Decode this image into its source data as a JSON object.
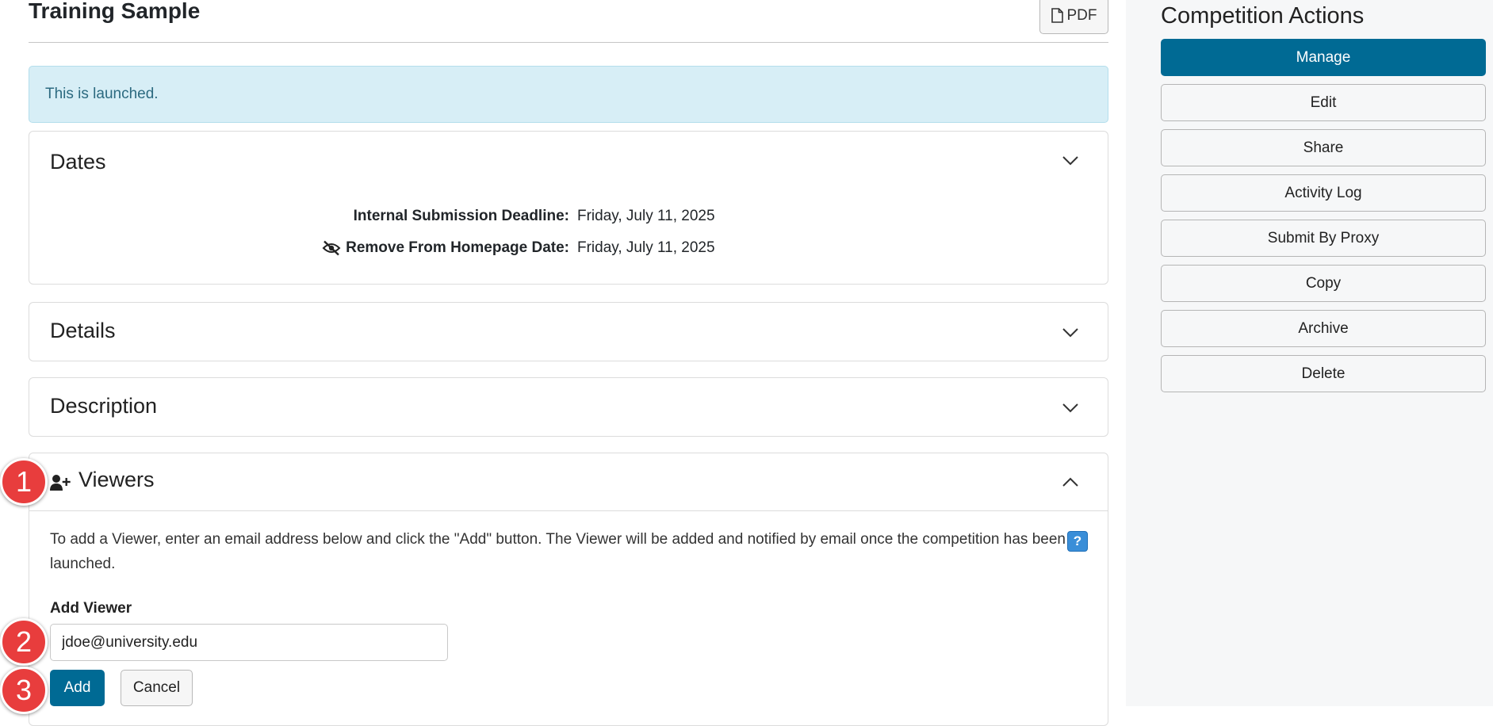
{
  "header": {
    "title": "Training Sample",
    "pdf_label": "PDF"
  },
  "alert": {
    "text": "This is launched."
  },
  "dates": {
    "title": "Dates",
    "rows": [
      {
        "label": "Internal Submission Deadline:",
        "value": "Friday, July 11, 2025"
      },
      {
        "label": "Remove From Homepage Date:",
        "value": "Friday, July 11, 2025",
        "icon": "eye-slash-icon"
      }
    ]
  },
  "details": {
    "title": "Details"
  },
  "description": {
    "title": "Description"
  },
  "viewers": {
    "title": "Viewers",
    "icon": "user-plus-icon",
    "help_text": "To add a Viewer, enter an email address below and click the \"Add\" button. The Viewer will be added and notified by email once the competition has been launched.",
    "help_badge": "?",
    "field_label": "Add Viewer",
    "email_value": "jdoe@university.edu",
    "add_label": "Add",
    "cancel_label": "Cancel"
  },
  "sidebar": {
    "title": "Competition Actions",
    "actions": [
      {
        "label": "Manage",
        "primary": true
      },
      {
        "label": "Edit"
      },
      {
        "label": "Share"
      },
      {
        "label": "Activity Log"
      },
      {
        "label": "Submit By Proxy"
      },
      {
        "label": "Copy"
      },
      {
        "label": "Archive"
      },
      {
        "label": "Delete"
      }
    ]
  },
  "callouts": [
    "1",
    "2",
    "3"
  ],
  "colors": {
    "primary": "#006a94",
    "alert_bg": "#d7eef6",
    "callout": "#e83d3d",
    "help_badge": "#3a8ed8"
  }
}
